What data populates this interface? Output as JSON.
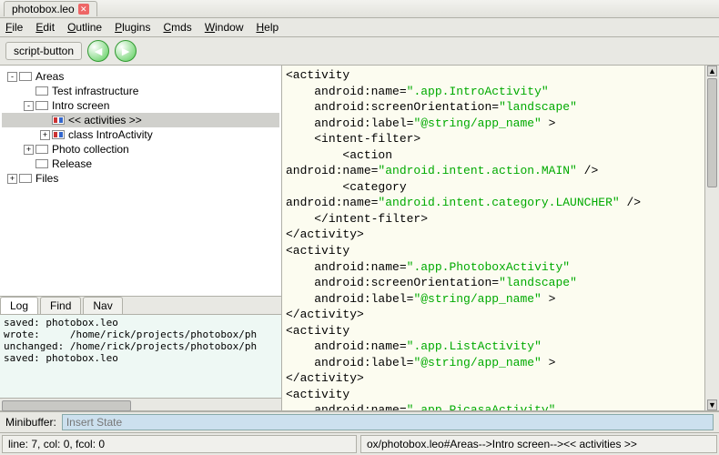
{
  "window": {
    "title": "photobox.leo"
  },
  "menu": [
    "File",
    "Edit",
    "Outline",
    "Plugins",
    "Cmds",
    "Window",
    "Help"
  ],
  "toolbar": {
    "script_button": "script-button"
  },
  "tree": {
    "items": [
      {
        "depth": 0,
        "exp": "-",
        "icon": "plain",
        "label": "Areas",
        "sel": false
      },
      {
        "depth": 1,
        "exp": "",
        "icon": "plain",
        "label": "Test infrastructure",
        "sel": false
      },
      {
        "depth": 1,
        "exp": "-",
        "icon": "plain",
        "label": "Intro screen",
        "sel": false
      },
      {
        "depth": 2,
        "exp": "",
        "icon": "marked",
        "label": "<< activities >>",
        "sel": true
      },
      {
        "depth": 2,
        "exp": "+",
        "icon": "marked",
        "label": "class IntroActivity",
        "sel": false
      },
      {
        "depth": 1,
        "exp": "+",
        "icon": "plain",
        "label": "Photo collection",
        "sel": false
      },
      {
        "depth": 1,
        "exp": "",
        "icon": "plain",
        "label": "Release",
        "sel": false
      },
      {
        "depth": 0,
        "exp": "+",
        "icon": "plain",
        "label": "Files",
        "sel": false
      }
    ]
  },
  "log": {
    "tabs": [
      "Log",
      "Find",
      "Nav"
    ],
    "active": 0,
    "lines": [
      "saved: photobox.leo",
      "wrote:     /home/rick/projects/photobox/ph",
      "unchanged: /home/rick/projects/photobox/ph",
      "saved: photobox.leo"
    ]
  },
  "editor": {
    "tokens": [
      {
        "t": "tag",
        "v": "<activity"
      },
      {
        "t": "nl"
      },
      {
        "t": "pad",
        "v": "    "
      },
      {
        "t": "attr",
        "v": "android:name="
      },
      {
        "t": "str",
        "v": "\".app.IntroActivity\""
      },
      {
        "t": "nl"
      },
      {
        "t": "pad",
        "v": "    "
      },
      {
        "t": "attr",
        "v": "android:screenOrientation="
      },
      {
        "t": "str",
        "v": "\"landscape\""
      },
      {
        "t": "nl"
      },
      {
        "t": "pad",
        "v": "    "
      },
      {
        "t": "attr",
        "v": "android:label="
      },
      {
        "t": "str",
        "v": "\"@string/app_name\""
      },
      {
        "t": "tag",
        "v": " >"
      },
      {
        "t": "nl"
      },
      {
        "t": "pad",
        "v": "    "
      },
      {
        "t": "tag",
        "v": "<intent-filter>"
      },
      {
        "t": "nl"
      },
      {
        "t": "pad",
        "v": "        "
      },
      {
        "t": "tag",
        "v": "<action"
      },
      {
        "t": "nl"
      },
      {
        "t": "attr",
        "v": "android:name="
      },
      {
        "t": "str",
        "v": "\"android.intent.action.MAIN\""
      },
      {
        "t": "tag",
        "v": " />"
      },
      {
        "t": "nl"
      },
      {
        "t": "pad",
        "v": "        "
      },
      {
        "t": "tag",
        "v": "<category"
      },
      {
        "t": "nl"
      },
      {
        "t": "attr",
        "v": "android:name="
      },
      {
        "t": "str",
        "v": "\"android.intent.category.LAUNCHER\""
      },
      {
        "t": "tag",
        "v": " />"
      },
      {
        "t": "nl"
      },
      {
        "t": "pad",
        "v": "    "
      },
      {
        "t": "tag",
        "v": "</intent-filter>"
      },
      {
        "t": "nl"
      },
      {
        "t": "tag",
        "v": "</activity>"
      },
      {
        "t": "nl"
      },
      {
        "t": "tag",
        "v": "<activity"
      },
      {
        "t": "nl"
      },
      {
        "t": "pad",
        "v": "    "
      },
      {
        "t": "attr",
        "v": "android:name="
      },
      {
        "t": "str",
        "v": "\".app.PhotoboxActivity\""
      },
      {
        "t": "nl"
      },
      {
        "t": "pad",
        "v": "    "
      },
      {
        "t": "attr",
        "v": "android:screenOrientation="
      },
      {
        "t": "str",
        "v": "\"landscape\""
      },
      {
        "t": "nl"
      },
      {
        "t": "pad",
        "v": "    "
      },
      {
        "t": "attr",
        "v": "android:label="
      },
      {
        "t": "str",
        "v": "\"@string/app_name\""
      },
      {
        "t": "tag",
        "v": " >"
      },
      {
        "t": "nl"
      },
      {
        "t": "tag",
        "v": "</activity>"
      },
      {
        "t": "nl"
      },
      {
        "t": "tag",
        "v": "<activity"
      },
      {
        "t": "nl"
      },
      {
        "t": "pad",
        "v": "    "
      },
      {
        "t": "attr",
        "v": "android:name="
      },
      {
        "t": "str",
        "v": "\".app.ListActivity\""
      },
      {
        "t": "nl"
      },
      {
        "t": "pad",
        "v": "    "
      },
      {
        "t": "attr",
        "v": "android:label="
      },
      {
        "t": "str",
        "v": "\"@string/app_name\""
      },
      {
        "t": "tag",
        "v": " >"
      },
      {
        "t": "nl"
      },
      {
        "t": "tag",
        "v": "</activity>"
      },
      {
        "t": "nl"
      },
      {
        "t": "tag",
        "v": "<activity"
      },
      {
        "t": "nl"
      },
      {
        "t": "pad",
        "v": "    "
      },
      {
        "t": "attr",
        "v": "android:name="
      },
      {
        "t": "str",
        "v": "\".app.PicasaActivity\""
      },
      {
        "t": "nl"
      }
    ]
  },
  "minibuffer": {
    "label": "Minibuffer:",
    "value": "Insert State"
  },
  "status": {
    "pos": "line: 7, col: 0, fcol: 0",
    "path": "ox/photobox.leo#Areas-->Intro screen--><< activities >>"
  }
}
